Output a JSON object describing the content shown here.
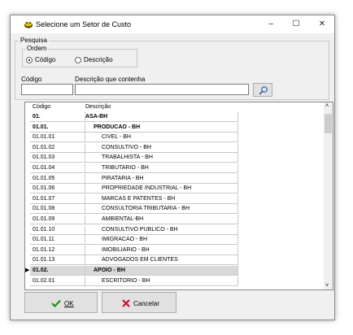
{
  "window": {
    "title": "Selecione um Setor de Custo"
  },
  "controls": {
    "minimize": "–",
    "maximize": "☐",
    "close": "✕"
  },
  "pesquisa": {
    "legend": "Pesquisa",
    "ordem": {
      "legend": "Ordem",
      "options": [
        "Código",
        "Descrição"
      ],
      "selected": "Código"
    },
    "codigo_label": "Código",
    "codigo_value": "",
    "descricao_label": "Descrição que contenha",
    "descricao_value": ""
  },
  "table": {
    "columns": [
      "Código",
      "Descrição"
    ],
    "rows": [
      {
        "codigo": "01.",
        "descricao": "ASA-BH",
        "level": 0,
        "bold": true
      },
      {
        "codigo": "01.01.",
        "descricao": "PRODUCAO - BH",
        "level": 1,
        "bold": true
      },
      {
        "codigo": "01.01.01",
        "descricao": "CIVEL - BH",
        "level": 2
      },
      {
        "codigo": "01.01.02",
        "descricao": "CONSULTIVO - BH",
        "level": 2
      },
      {
        "codigo": "01.01.03",
        "descricao": "TRABALHISTA - BH",
        "level": 2
      },
      {
        "codigo": "01.01.04",
        "descricao": "TRIBUTARIO - BH",
        "level": 2
      },
      {
        "codigo": "01.01.05",
        "descricao": "PIRATARIA - BH",
        "level": 2
      },
      {
        "codigo": "01.01.06",
        "descricao": "PROPRIEDADE INDUSTRIAL - BH",
        "level": 2
      },
      {
        "codigo": "01.01.07",
        "descricao": "MARCAS E PATENTES - BH",
        "level": 2
      },
      {
        "codigo": "01.01.08",
        "descricao": "CONSULTORIA TRIBUTARIA - BH",
        "level": 2
      },
      {
        "codigo": "01.01.09",
        "descricao": "AMBIENTAL-BH",
        "level": 2
      },
      {
        "codigo": "01.01.10",
        "descricao": "CONSULTIVO PUBLICO - BH",
        "level": 2
      },
      {
        "codigo": "01.01.11",
        "descricao": "IMIGRACAO - BH",
        "level": 2
      },
      {
        "codigo": "01.01.12",
        "descricao": "IMOBILIARIO - BH",
        "level": 2
      },
      {
        "codigo": "01.01.13",
        "descricao": "ADVOGADOS EM CLIENTES",
        "level": 2
      },
      {
        "codigo": "01.02.",
        "descricao": "APOIO - BH",
        "level": 1,
        "bold": true,
        "selected": true
      },
      {
        "codigo": "01.02.01",
        "descricao": "ESCRITORIO - BH",
        "level": 2
      }
    ]
  },
  "buttons": {
    "ok": "OK",
    "cancel": "Cancelar"
  },
  "colors": {
    "ok_check": "#1f8f1f",
    "cancel_x": "#c8102e"
  }
}
